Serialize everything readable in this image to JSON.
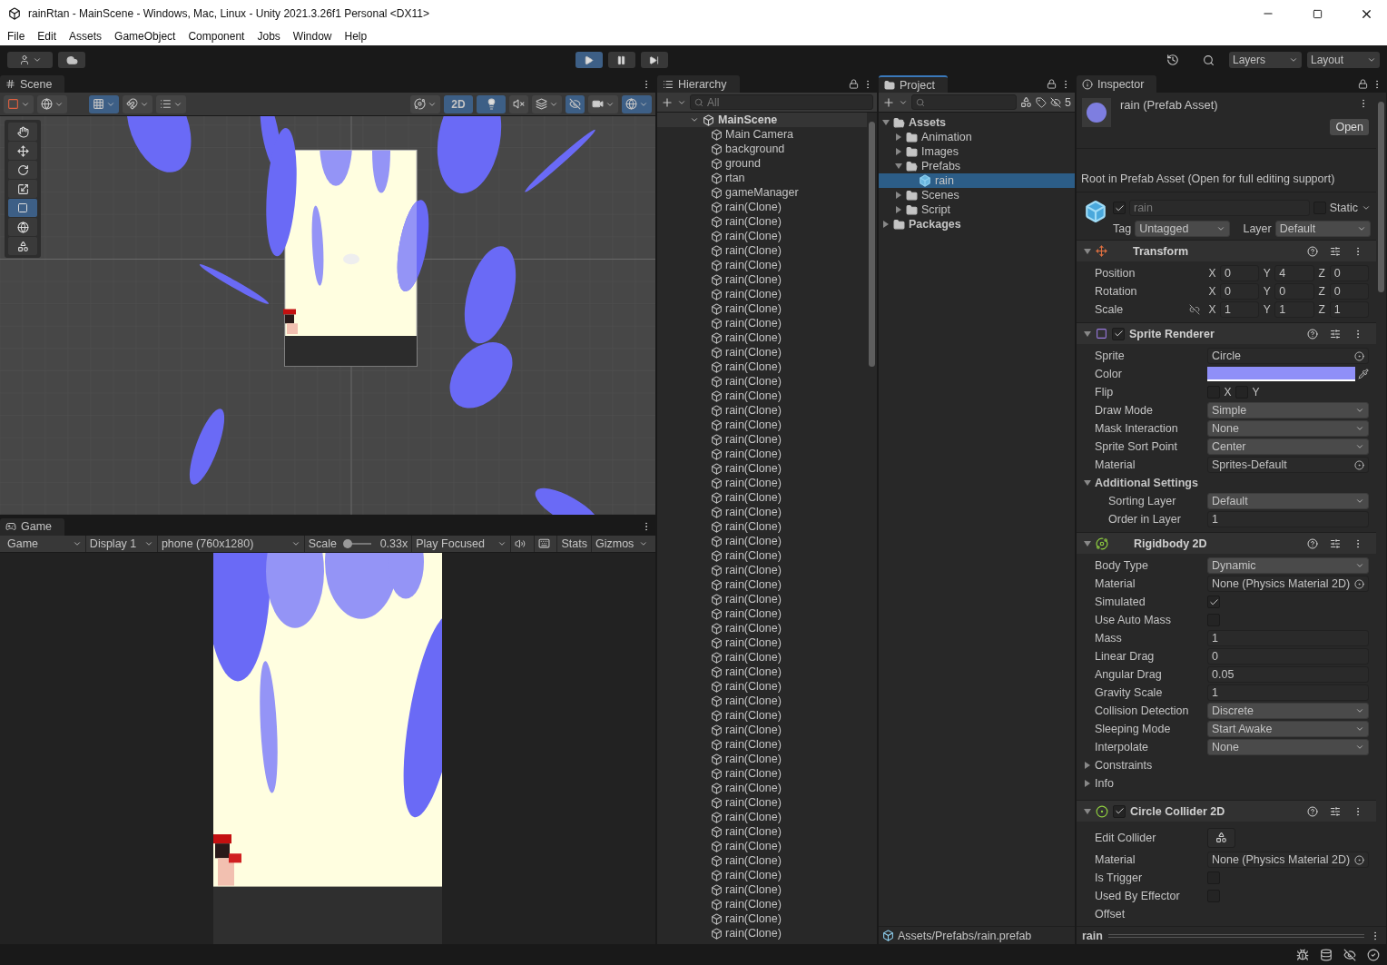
{
  "window": {
    "title": "rainRtan - MainScene - Windows, Mac, Linux - Unity 2021.3.26f1 Personal <DX11>"
  },
  "menu": [
    "File",
    "Edit",
    "Assets",
    "GameObject",
    "Component",
    "Jobs",
    "Window",
    "Help"
  ],
  "toolbar": {
    "playing": true,
    "paused": false,
    "layers": "Layers",
    "layout": "Layout"
  },
  "scene": {
    "tab": "Scene",
    "mode_2d": "2D",
    "is_2d": true,
    "lighting": true
  },
  "game": {
    "tab": "Game",
    "view": "Game",
    "display": "Display 1",
    "resolution": "phone (760x1280)",
    "scale": {
      "label": "Scale",
      "level": 0.05,
      "value": "0.33x"
    },
    "play_mode": "Play Focused",
    "stats": "Stats",
    "gizmos": "Gizmos"
  },
  "hierarchy": {
    "tab": "Hierarchy",
    "search_placeholder": "All",
    "scene": "MainScene",
    "items": [
      "Main Camera",
      "background",
      "ground",
      "rtan",
      "gameManager",
      "rain(Clone)",
      "rain(Clone)",
      "rain(Clone)",
      "rain(Clone)",
      "rain(Clone)",
      "rain(Clone)",
      "rain(Clone)",
      "rain(Clone)",
      "rain(Clone)",
      "rain(Clone)",
      "rain(Clone)",
      "rain(Clone)",
      "rain(Clone)",
      "rain(Clone)",
      "rain(Clone)",
      "rain(Clone)",
      "rain(Clone)",
      "rain(Clone)",
      "rain(Clone)",
      "rain(Clone)",
      "rain(Clone)",
      "rain(Clone)",
      "rain(Clone)",
      "rain(Clone)",
      "rain(Clone)",
      "rain(Clone)",
      "rain(Clone)",
      "rain(Clone)",
      "rain(Clone)",
      "rain(Clone)",
      "rain(Clone)",
      "rain(Clone)",
      "rain(Clone)",
      "rain(Clone)",
      "rain(Clone)",
      "rain(Clone)",
      "rain(Clone)",
      "rain(Clone)",
      "rain(Clone)",
      "rain(Clone)",
      "rain(Clone)",
      "rain(Clone)",
      "rain(Clone)",
      "rain(Clone)",
      "rain(Clone)",
      "rain(Clone)",
      "rain(Clone)",
      "rain(Clone)",
      "rain(Clone)",
      "rain(Clone)",
      "rain(Clone)"
    ]
  },
  "project": {
    "tab": "Project",
    "hidden_count": "5",
    "tree": [
      {
        "label": "Assets",
        "kind": "folder",
        "expanded": true,
        "selected": false,
        "children": [
          {
            "label": "Animation",
            "kind": "folder",
            "expanded": false,
            "selected": false
          },
          {
            "label": "Images",
            "kind": "folder",
            "expanded": false,
            "selected": false
          },
          {
            "label": "Prefabs",
            "kind": "folder",
            "expanded": true,
            "selected": false,
            "children": [
              {
                "label": "rain",
                "kind": "prefab",
                "selected": true
              }
            ]
          },
          {
            "label": "Scenes",
            "kind": "folder",
            "expanded": false,
            "selected": false
          },
          {
            "label": "Script",
            "kind": "folder",
            "expanded": false,
            "selected": false
          }
        ]
      },
      {
        "label": "Packages",
        "kind": "folder",
        "expanded": false,
        "selected": false
      }
    ],
    "path": "Assets/Prefabs/rain.prefab"
  },
  "inspector": {
    "tab": "Inspector",
    "title": "rain (Prefab Asset)",
    "open": "Open",
    "note": "Root in Prefab Asset (Open for full editing support)",
    "object": {
      "active": true,
      "name": "rain",
      "static": false,
      "static_label": "Static",
      "tag_label": "Tag",
      "tag": "Untagged",
      "layer_label": "Layer",
      "layer": "Default"
    },
    "components": [
      {
        "title": "Transform",
        "kind": "transform",
        "expanded": true,
        "rows": [
          {
            "kind": "vector",
            "label": "Position",
            "values": [
              {
                "axis": "X",
                "value": "0"
              },
              {
                "axis": "Y",
                "value": "4"
              },
              {
                "axis": "Z",
                "value": "0"
              }
            ]
          },
          {
            "kind": "vector",
            "label": "Rotation",
            "values": [
              {
                "axis": "X",
                "value": "0"
              },
              {
                "axis": "Y",
                "value": "0"
              },
              {
                "axis": "Z",
                "value": "0"
              }
            ]
          },
          {
            "kind": "vector",
            "label": "Scale",
            "linked": false,
            "values": [
              {
                "axis": "X",
                "value": "1"
              },
              {
                "axis": "Y",
                "value": "1"
              },
              {
                "axis": "Z",
                "value": "1"
              }
            ]
          }
        ]
      },
      {
        "title": "Sprite Renderer",
        "kind": "sprite",
        "expanded": true,
        "enabled": true,
        "rows": [
          {
            "kind": "object",
            "label": "Sprite",
            "value": "Circle"
          },
          {
            "kind": "color",
            "label": "Color",
            "color": "#8f8ff8"
          },
          {
            "kind": "flip",
            "label": "Flip",
            "values": [
              {
                "axis": "X",
                "checked": false
              },
              {
                "axis": "Y",
                "checked": false
              }
            ]
          },
          {
            "kind": "dropdown",
            "label": "Draw Mode",
            "value": "Simple"
          },
          {
            "kind": "dropdown",
            "label": "Mask Interaction",
            "value": "None"
          },
          {
            "kind": "dropdown",
            "label": "Sprite Sort Point",
            "value": "Center"
          },
          {
            "kind": "object",
            "label": "Material",
            "value": "Sprites-Default"
          },
          {
            "kind": "foldout",
            "label": "Additional Settings",
            "expanded": true,
            "children": [
              {
                "kind": "dropdown",
                "label": "Sorting Layer",
                "value": "Default"
              },
              {
                "kind": "number",
                "label": "Order in Layer",
                "value": "1"
              }
            ]
          }
        ]
      },
      {
        "title": "Rigidbody 2D",
        "kind": "rigidbody",
        "expanded": true,
        "rows": [
          {
            "kind": "dropdown",
            "label": "Body Type",
            "value": "Dynamic"
          },
          {
            "kind": "object",
            "label": "Material",
            "value": "None (Physics Material 2D)"
          },
          {
            "kind": "checkbox",
            "label": "Simulated",
            "checked": true
          },
          {
            "kind": "checkbox",
            "label": "Use Auto Mass",
            "checked": false
          },
          {
            "kind": "number",
            "label": "Mass",
            "value": "1"
          },
          {
            "kind": "number",
            "label": "Linear Drag",
            "value": "0"
          },
          {
            "kind": "number",
            "label": "Angular Drag",
            "value": "0.05"
          },
          {
            "kind": "number",
            "label": "Gravity Scale",
            "value": "1"
          },
          {
            "kind": "dropdown",
            "label": "Collision Detection",
            "value": "Discrete"
          },
          {
            "kind": "dropdown",
            "label": "Sleeping Mode",
            "value": "Start Awake"
          },
          {
            "kind": "dropdown",
            "label": "Interpolate",
            "value": "None"
          },
          {
            "kind": "foldout",
            "label": "Constraints",
            "expanded": false
          },
          {
            "kind": "foldout",
            "label": "Info",
            "expanded": false
          }
        ]
      },
      {
        "title": "Circle Collider 2D",
        "kind": "collider",
        "expanded": true,
        "enabled": true,
        "rows": [
          {
            "kind": "button",
            "label": "Edit Collider"
          },
          {
            "kind": "object",
            "label": "Material",
            "value": "None (Physics Material 2D)"
          },
          {
            "kind": "checkbox",
            "label": "Is Trigger",
            "checked": false
          },
          {
            "kind": "checkbox",
            "label": "Used By Effector",
            "checked": false
          },
          {
            "kind": "label",
            "label": "Offset"
          }
        ]
      }
    ],
    "footer": "rain"
  }
}
